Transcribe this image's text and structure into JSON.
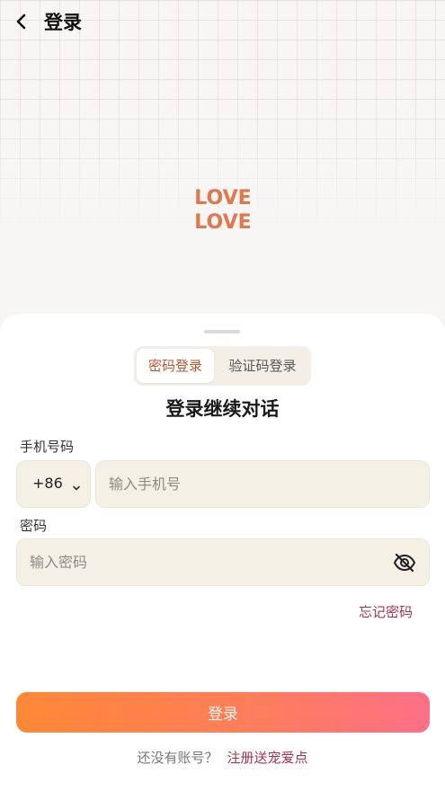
{
  "nav": {
    "title": "登录",
    "back_icon": "chevron-left-icon"
  },
  "logo": {
    "line1": "LOVE",
    "line2": "LOVE",
    "color": "#e0774d"
  },
  "tabs": [
    {
      "label": "密码登录",
      "active": true
    },
    {
      "label": "验证码登录",
      "active": false
    }
  ],
  "heading": "登录继续对话",
  "phone": {
    "label": "手机号码",
    "country_code": "+86",
    "placeholder": "输入手机号"
  },
  "password": {
    "label": "密码",
    "placeholder": "输入密码",
    "visibility_icon": "eye-off-icon"
  },
  "forgot_label": "忘记密码",
  "login_button": "登录",
  "footer": {
    "question": "还没有账号？",
    "register_link": "注册送宠爱点"
  },
  "colors": {
    "accent": "#b9552f",
    "link": "#a8324e",
    "button_start": "#ff8836",
    "button_end": "#ff6f86",
    "field_bg": "#f5f0e6"
  }
}
